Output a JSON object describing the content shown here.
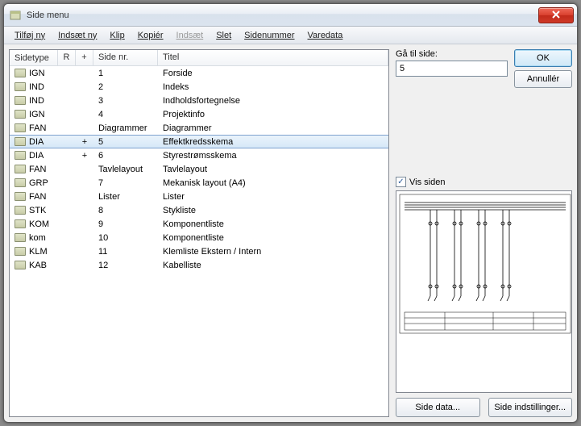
{
  "window": {
    "title": "Side menu"
  },
  "menu": {
    "tilfoj": "Tilføj ny",
    "indsaet_ny": "Indsæt ny",
    "klip": "Klip",
    "kopier": "Kopiér",
    "indsaet": "Indsæt",
    "slet": "Slet",
    "sidenummer": "Sidenummer",
    "varedata": "Varedata"
  },
  "cols": {
    "sidetype": "Sidetype",
    "r": "R",
    "plus": "+",
    "sidenr": "Side nr.",
    "titel": "Titel"
  },
  "rows": [
    {
      "type": "IGN",
      "plus": "",
      "nr": "1",
      "titel": "Forside",
      "sel": false
    },
    {
      "type": "IND",
      "plus": "",
      "nr": "2",
      "titel": "Indeks",
      "sel": false
    },
    {
      "type": "IND",
      "plus": "",
      "nr": "3",
      "titel": "Indholdsfortegnelse",
      "sel": false
    },
    {
      "type": "IGN",
      "plus": "",
      "nr": "4",
      "titel": "Projektinfo",
      "sel": false
    },
    {
      "type": "FAN",
      "plus": "",
      "nr": "Diagrammer",
      "titel": "Diagrammer",
      "sel": false
    },
    {
      "type": "DIA",
      "plus": "+",
      "nr": "5",
      "titel": "Effektkredsskema",
      "sel": true
    },
    {
      "type": "DIA",
      "plus": "+",
      "nr": "6",
      "titel": "Styrestrømsskema",
      "sel": false
    },
    {
      "type": "FAN",
      "plus": "",
      "nr": "Tavlelayout",
      "titel": "Tavlelayout",
      "sel": false
    },
    {
      "type": "GRP",
      "plus": "",
      "nr": "7",
      "titel": "Mekanisk layout (A4)",
      "sel": false
    },
    {
      "type": "FAN",
      "plus": "",
      "nr": "Lister",
      "titel": "Lister",
      "sel": false
    },
    {
      "type": "STK",
      "plus": "",
      "nr": "8",
      "titel": "Stykliste",
      "sel": false
    },
    {
      "type": "KOM",
      "plus": "",
      "nr": "9",
      "titel": "Komponentliste",
      "sel": false
    },
    {
      "type": "kom",
      "plus": "",
      "nr": "10",
      "titel": "Komponentliste",
      "sel": false
    },
    {
      "type": "KLM",
      "plus": "",
      "nr": "11",
      "titel": "Klemliste Ekstern / Intern",
      "sel": false
    },
    {
      "type": "KAB",
      "plus": "",
      "nr": "12",
      "titel": "Kabelliste",
      "sel": false
    }
  ],
  "goto": {
    "label": "Gå til side:",
    "value": "5"
  },
  "buttons": {
    "ok": "OK",
    "cancel": "Annullér"
  },
  "checkbox": {
    "label": "Vis siden",
    "checked": true
  },
  "bottom": {
    "data": "Side data...",
    "settings": "Side indstillinger..."
  }
}
